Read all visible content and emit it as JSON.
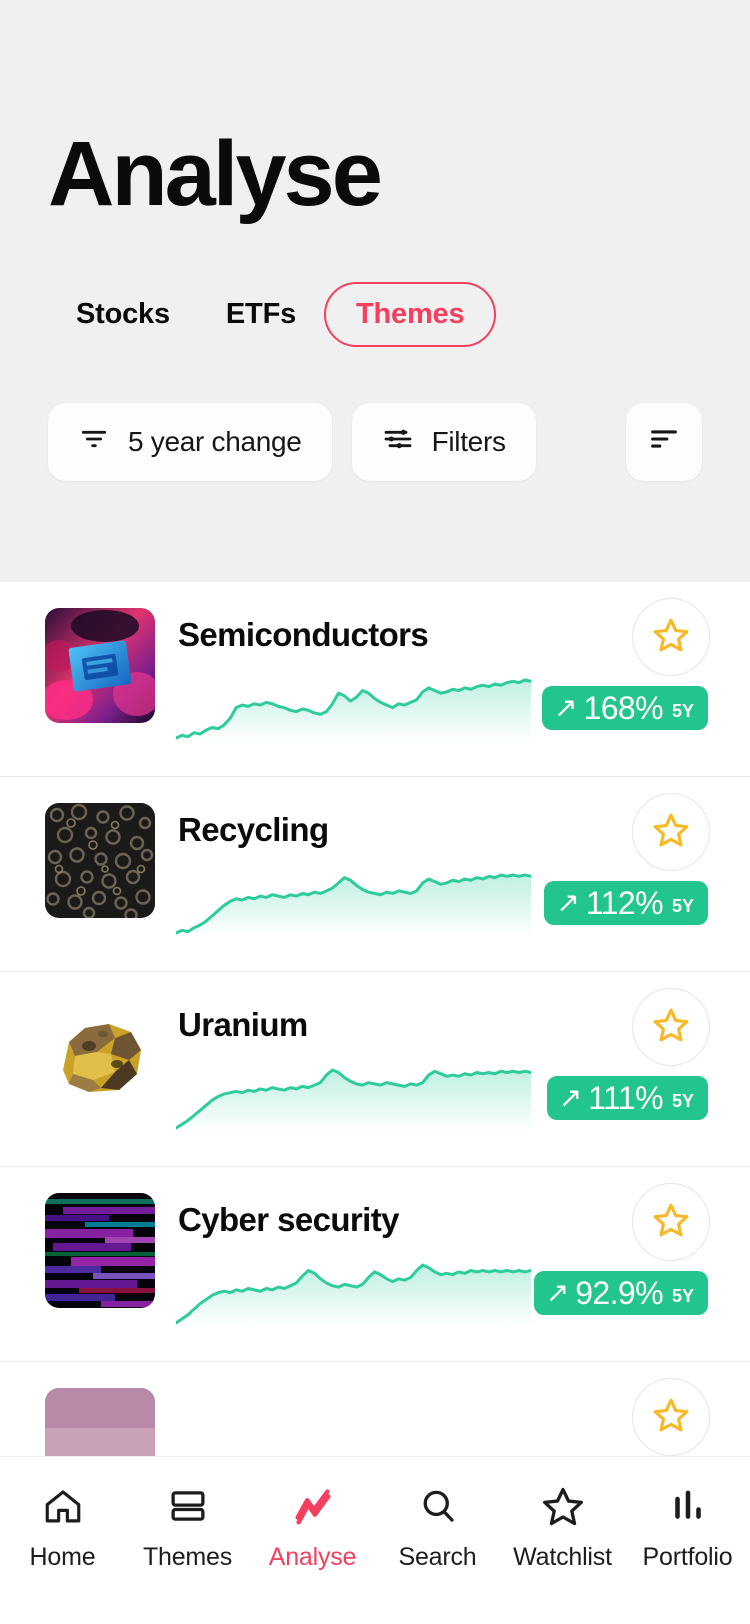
{
  "header": {
    "title": "Analyse",
    "tabs": [
      {
        "label": "Stocks",
        "active": false
      },
      {
        "label": "ETFs",
        "active": false
      },
      {
        "label": "Themes",
        "active": true
      }
    ],
    "accent_color": "#F43F5E",
    "background_color": "#F0F0F0"
  },
  "filterbar": {
    "sort": {
      "label": "5 year change",
      "icon": "sort-descending-icon"
    },
    "filters": {
      "label": "Filters",
      "icon": "sliders-icon"
    },
    "order": {
      "icon": "sort-order-icon"
    }
  },
  "list": {
    "rows": [
      {
        "name": "Semiconductors",
        "thumbnail": "semiconductor-chip-image",
        "change_pct": "168%",
        "period": "5Y",
        "direction": "up",
        "arrow": "↗",
        "starred": false,
        "sparkline": [
          18,
          20,
          19,
          22,
          21,
          24,
          26,
          25,
          28,
          33,
          41,
          43,
          42,
          44,
          43,
          45,
          44,
          42,
          41,
          39,
          38,
          40,
          39,
          37,
          36,
          38,
          44,
          52,
          50,
          46,
          49,
          54,
          52,
          48,
          45,
          43,
          41,
          44,
          43,
          45,
          47,
          53,
          56,
          54,
          52,
          53,
          55,
          54,
          56,
          55,
          57,
          58,
          57,
          59,
          58,
          60,
          61,
          60,
          62,
          61
        ]
      },
      {
        "name": "Recycling",
        "thumbnail": "scrap-metal-image",
        "change_pct": "112%",
        "period": "5Y",
        "direction": "up",
        "arrow": "↗",
        "starred": false,
        "sparkline": [
          14,
          16,
          15,
          18,
          20,
          23,
          27,
          31,
          35,
          38,
          40,
          39,
          41,
          40,
          42,
          41,
          43,
          42,
          41,
          43,
          42,
          44,
          43,
          45,
          44,
          46,
          48,
          52,
          56,
          54,
          50,
          47,
          45,
          44,
          43,
          45,
          44,
          46,
          45,
          44,
          46,
          52,
          55,
          53,
          51,
          52,
          54,
          53,
          55,
          54,
          56,
          55,
          57,
          56,
          58,
          57,
          58,
          57,
          58,
          57
        ]
      },
      {
        "name": "Uranium",
        "thumbnail": "uranium-ore-image",
        "change_pct": "111%",
        "period": "5Y",
        "direction": "up",
        "arrow": "↗",
        "starred": false,
        "sparkline": [
          16,
          19,
          22,
          26,
          30,
          34,
          38,
          41,
          43,
          44,
          45,
          44,
          46,
          45,
          47,
          46,
          48,
          47,
          46,
          48,
          47,
          49,
          48,
          50,
          52,
          58,
          62,
          60,
          56,
          53,
          51,
          50,
          52,
          51,
          50,
          52,
          51,
          50,
          49,
          51,
          50,
          52,
          58,
          61,
          59,
          57,
          58,
          57,
          59,
          58,
          60,
          59,
          60,
          59,
          61,
          60,
          61,
          60,
          61,
          60
        ]
      },
      {
        "name": "Cyber security",
        "thumbnail": "glitch-abstract-image",
        "change_pct": "92.9%",
        "period": "5Y",
        "direction": "up",
        "arrow": "↗",
        "starred": false,
        "sparkline": [
          20,
          23,
          26,
          30,
          34,
          37,
          40,
          42,
          43,
          42,
          44,
          43,
          45,
          44,
          43,
          45,
          44,
          46,
          45,
          47,
          49,
          54,
          58,
          56,
          52,
          49,
          47,
          46,
          48,
          47,
          46,
          48,
          53,
          57,
          55,
          52,
          50,
          52,
          51,
          53,
          58,
          62,
          60,
          57,
          55,
          56,
          55,
          57,
          56,
          58,
          57,
          58,
          57,
          58,
          57,
          58,
          57,
          58,
          57,
          58
        ]
      }
    ]
  },
  "bottomnav": {
    "items": [
      {
        "label": "Home",
        "icon": "home-icon",
        "active": false
      },
      {
        "label": "Themes",
        "icon": "stacked-rows-icon",
        "active": false
      },
      {
        "label": "Analyse",
        "icon": "zigzag-chart-icon",
        "active": true
      },
      {
        "label": "Search",
        "icon": "magnifier-icon",
        "active": false
      },
      {
        "label": "Watchlist",
        "icon": "star-icon",
        "active": false
      },
      {
        "label": "Portfolio",
        "icon": "bar-chart-icon",
        "active": false
      }
    ],
    "active_color": "#F43F5E"
  },
  "colors": {
    "sparkline": "#2ECC9B",
    "badge": "#22C58B",
    "star": "#F7B928",
    "accent": "#F43F5E"
  }
}
